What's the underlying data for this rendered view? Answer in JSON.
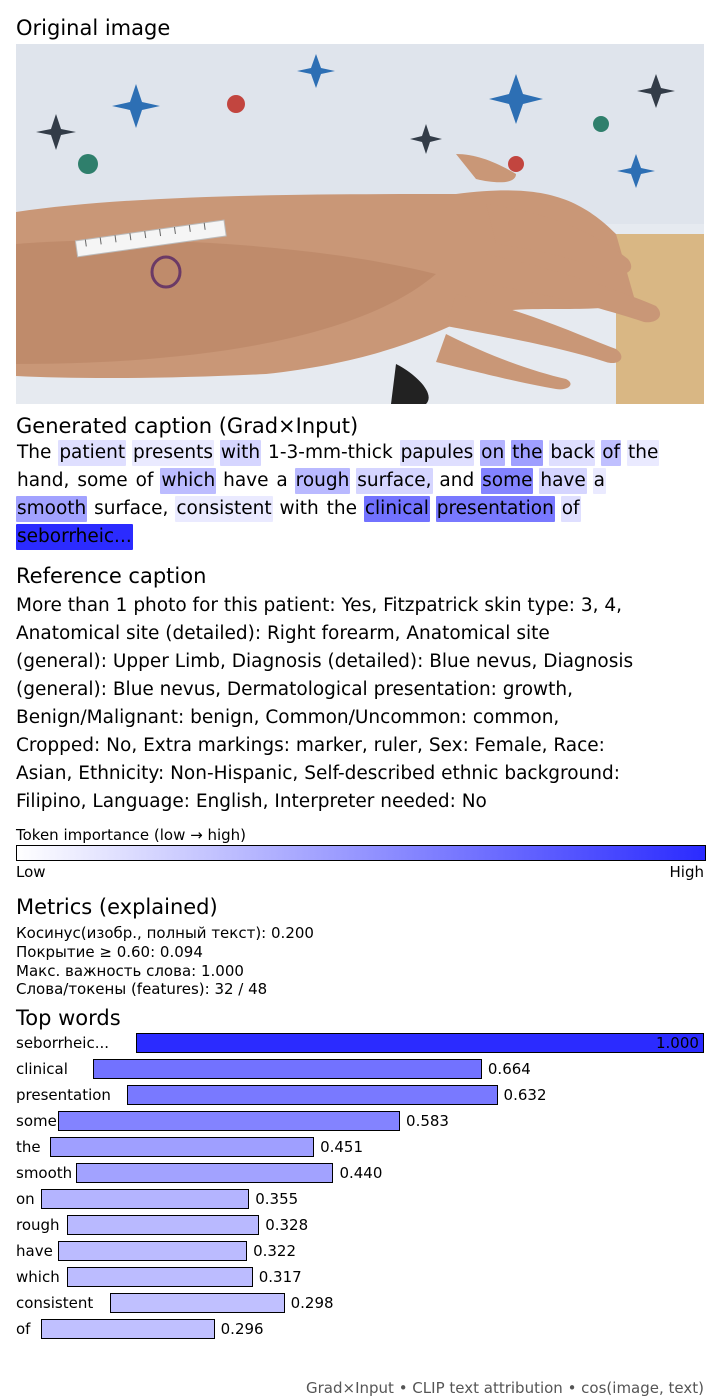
{
  "sections": {
    "original_title": "Original image",
    "generated_title": "Generated caption (Grad×Input)",
    "reference_title": "Reference caption",
    "metrics_title": "Metrics (explained)",
    "topwords_title": "Top words"
  },
  "generated_caption": {
    "lines": [
      [
        [
          "The",
          0
        ],
        [
          "patient",
          0.15
        ],
        [
          "presents",
          0.1
        ],
        [
          "with",
          0.2
        ],
        [
          "1-3-mm-thick",
          0
        ],
        [
          "papules",
          0.15
        ],
        [
          "on",
          0.355
        ],
        [
          "the",
          0.451
        ],
        [
          "back",
          0.15
        ],
        [
          "of",
          0.296
        ],
        [
          "the",
          0.1
        ]
      ],
      [
        [
          "hand,",
          0
        ],
        [
          "some",
          0
        ],
        [
          "of",
          0
        ],
        [
          "which",
          0.317
        ],
        [
          "have",
          0
        ],
        [
          "a",
          0
        ],
        [
          "rough",
          0.328
        ],
        [
          "surface,",
          0.2
        ],
        [
          "and",
          0
        ],
        [
          "some",
          0.583
        ],
        [
          "have",
          0.2
        ],
        [
          "a",
          0.1
        ]
      ],
      [
        [
          "smooth",
          0.44
        ],
        [
          "surface,",
          0
        ],
        [
          "consistent",
          0.1
        ],
        [
          "with",
          0
        ],
        [
          "the",
          0
        ],
        [
          "clinical",
          0.664
        ],
        [
          "presentation",
          0.632
        ],
        [
          "of",
          0.15
        ]
      ],
      [
        [
          "seborrheic...",
          1.0
        ]
      ]
    ]
  },
  "reference_caption": {
    "lines": [
      "More than 1 photo for this patient: Yes, Fitzpatrick skin type: 3, 4,",
      "Anatomical site (detailed): Right forearm, Anatomical site",
      "(general): Upper Limb, Diagnosis (detailed): Blue nevus, Diagnosis",
      "(general): Blue nevus, Dermatological presentation: growth,",
      "Benign/Malignant: benign, Common/Uncommon: common,",
      "Cropped: No, Extra markings: marker, ruler, Sex: Female, Race:",
      "Asian, Ethnicity: Non-Hispanic, Self-described ethnic background:",
      "Filipino, Language: English, Interpreter needed: No"
    ]
  },
  "colorbar": {
    "title": "Token importance (low → high)",
    "low_label": "Low",
    "high_label": "High",
    "low_color": "#ffffff",
    "high_color": "#2b2bff"
  },
  "metrics": {
    "cosine": "Косинус(изобр., полный текст): 0.200",
    "coverage": "Покрытие ≥ 0.60: 0.094",
    "max_importance": "Макс. важность слова: 1.000",
    "words_tokens": "Слова/токены (features): 32 / 48"
  },
  "chart_data": {
    "type": "bar",
    "orientation": "horizontal",
    "title": "Top words",
    "categories": [
      "seborrheic...",
      "clinical",
      "presentation",
      "some",
      "the",
      "smooth",
      "on",
      "rough",
      "have",
      "which",
      "consistent",
      "of"
    ],
    "values": [
      1.0,
      0.664,
      0.632,
      0.583,
      0.451,
      0.44,
      0.355,
      0.328,
      0.322,
      0.317,
      0.298,
      0.296
    ],
    "value_labels": [
      "1.000",
      "0.664",
      "0.632",
      "0.583",
      "0.451",
      "0.440",
      "0.355",
      "0.328",
      "0.322",
      "0.317",
      "0.298",
      "0.296"
    ],
    "xlim": [
      0,
      1
    ],
    "grid": false
  },
  "footer": "Grad×Input • CLIP text attribution • cos(image, text)"
}
